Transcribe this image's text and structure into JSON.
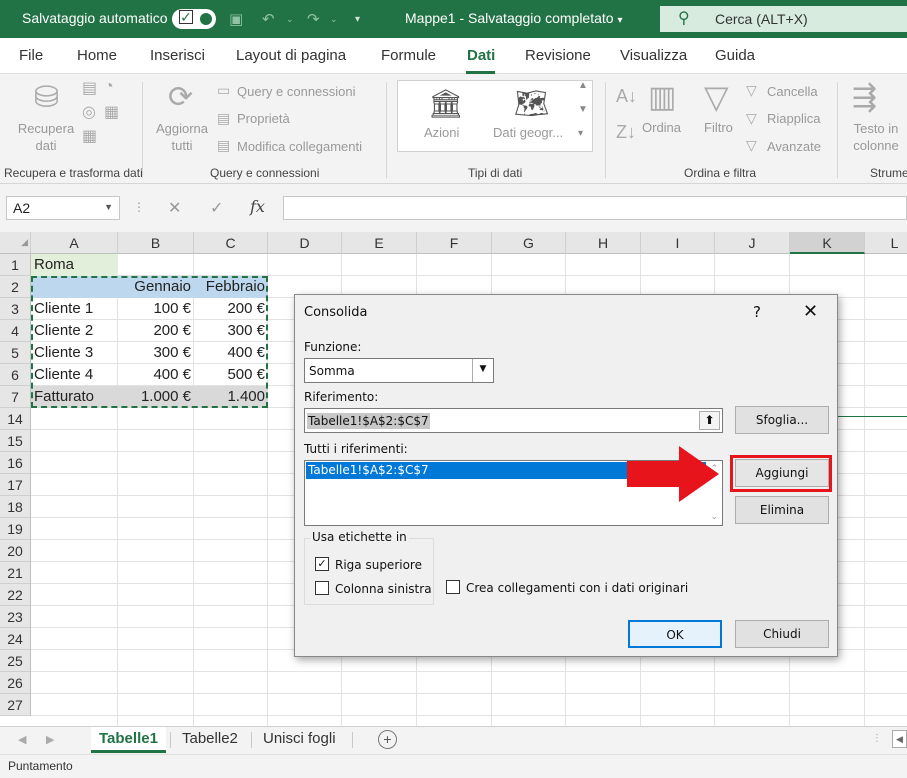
{
  "titlebar": {
    "autosave_label": "Salvataggio automatico",
    "document_title": "Mappe1 - Salvataggio completato",
    "search_placeholder": "Cerca (ALT+X)"
  },
  "menu": {
    "tabs": [
      "File",
      "Home",
      "Inserisci",
      "Layout di pagina",
      "Formule",
      "Dati",
      "Revisione",
      "Visualizza",
      "Guida"
    ],
    "active": "Dati"
  },
  "ribbon": {
    "recupera_label": "Recupera dati",
    "query_connessioni": "Query e connessioni",
    "proprieta": "Proprietà",
    "modifica_collegamenti": "Modifica collegamenti",
    "aggiorna_label": "Aggiorna tutti",
    "azioni": "Azioni",
    "dati_geogr": "Dati geogr...",
    "ordina": "Ordina",
    "filtro": "Filtro",
    "cancella": "Cancella",
    "riapplica": "Riapplica",
    "avanzate": "Avanzate",
    "testo_colonne": "Testo in colonne",
    "groups": {
      "recupera": "Recupera e trasforma dati",
      "query": "Query e connessioni",
      "tipi": "Tipi di dati",
      "ordina": "Ordina e filtra",
      "strumenti": "Strume"
    }
  },
  "formula_bar": {
    "name_box": "A2",
    "fx_label": "fx",
    "formula": ""
  },
  "sheet": {
    "columns": [
      "A",
      "B",
      "C",
      "D",
      "E",
      "F",
      "G",
      "H",
      "I",
      "J",
      "K",
      "L"
    ],
    "selected_column": "K",
    "row_numbers": [
      "1",
      "2",
      "3",
      "4",
      "5",
      "6",
      "7",
      "14",
      "15",
      "16",
      "17",
      "18",
      "19",
      "20",
      "21",
      "22",
      "23",
      "24",
      "25",
      "26",
      "27"
    ],
    "cells": {
      "A1": "Roma",
      "B2": "Gennaio",
      "C2": "Febbraio",
      "A3": "Cliente 1",
      "B3": "100 €",
      "C3": "200 €",
      "A4": "Cliente 2",
      "B4": "200 €",
      "C4": "300 €",
      "A5": "Cliente 3",
      "B5": "300 €",
      "C5": "400 €",
      "A6": "Cliente 4",
      "B6": "400 €",
      "C6": "500 €",
      "A7": "Fatturato",
      "B7": "1.000 €",
      "C7": "1.400"
    }
  },
  "dialog": {
    "title": "Consolida",
    "help": "?",
    "close": "✕",
    "funzione_label": "Funzione:",
    "funzione_value": "Somma",
    "riferimento_label": "Riferimento:",
    "riferimento_value": "Tabelle1!$A$2:$C$7",
    "sfoglia": "Sfoglia...",
    "tutti_label": "Tutti i riferimenti:",
    "tutti_items": [
      "Tabelle1!$A$2:$C$7"
    ],
    "aggiungi": "Aggiungi",
    "elimina": "Elimina",
    "usa_etichette": "Usa etichette in",
    "riga_superiore": "Riga superiore",
    "riga_superiore_checked": true,
    "colonna_sinistra": "Colonna sinistra",
    "colonna_sinistra_checked": false,
    "crea_collegamenti": "Crea collegamenti con i dati originari",
    "crea_collegamenti_checked": false,
    "ok": "OK",
    "chiudi": "Chiudi"
  },
  "sheet_tabs": {
    "tabs": [
      "Tabelle1",
      "Tabelle2",
      "Unisci fogli"
    ],
    "active": "Tabelle1"
  },
  "status": {
    "mode": "Puntamento"
  },
  "colors": {
    "excel_green": "#217346",
    "highlight_red": "#e8141c",
    "header_blue": "#bdd7ee",
    "total_gray": "#d9d9d9",
    "roma_green": "#e2efda"
  }
}
